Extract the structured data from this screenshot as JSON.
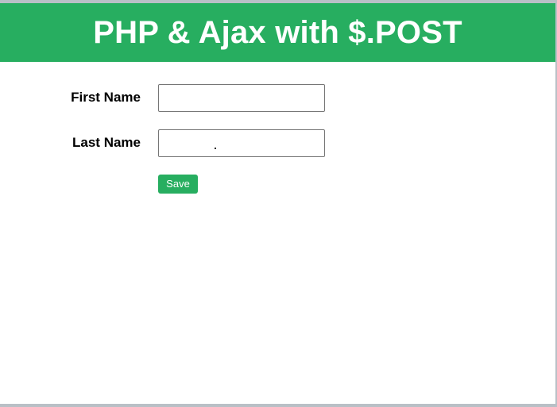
{
  "header": {
    "title": "PHP & Ajax with $.POST"
  },
  "form": {
    "first_name": {
      "label": "First Name",
      "value": "",
      "placeholder": ""
    },
    "last_name": {
      "label": "Last Name",
      "value": "",
      "placeholder": ""
    },
    "save_label": "Save"
  },
  "colors": {
    "accent": "#27ae60",
    "header_text": "#ffffff",
    "frame_border": "#b9c0c6"
  }
}
